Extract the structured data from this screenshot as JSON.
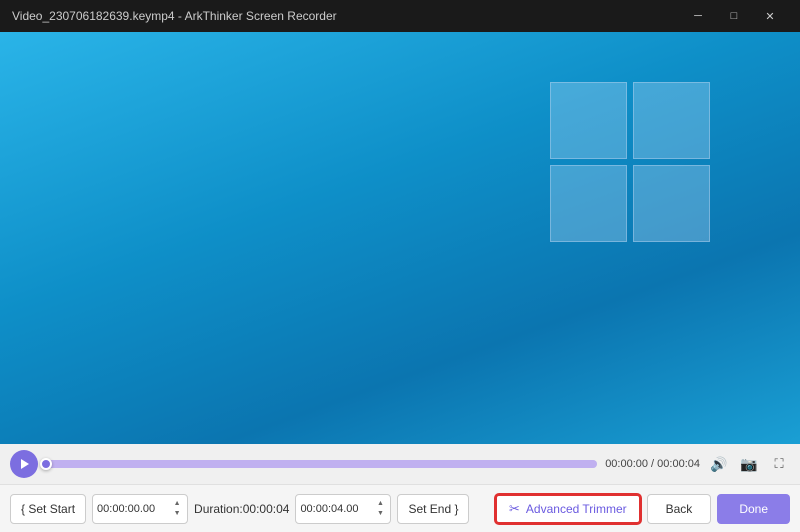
{
  "titleBar": {
    "title": "Video_230706182639.keymp4 - ArkThinker Screen Recorder",
    "minimizeLabel": "─",
    "maximizeLabel": "□",
    "closeLabel": "✕"
  },
  "toolbar": {
    "timeDisplay": "00:00:00 / 00:00:04",
    "volumeIcon": "🔊",
    "cameraIcon": "📷",
    "fullscreenIcon": "⛶"
  },
  "bottomBar": {
    "setStartLabel": "{ Set Start",
    "startTime": "00:00:00.00",
    "durationLabel": "Duration:00:00:04",
    "endTime": "00:00:04.00",
    "setEndLabel": "Set End }",
    "advancedTrimmerLabel": "Advanced Trimmer",
    "backLabel": "Back",
    "doneLabel": "Done"
  }
}
